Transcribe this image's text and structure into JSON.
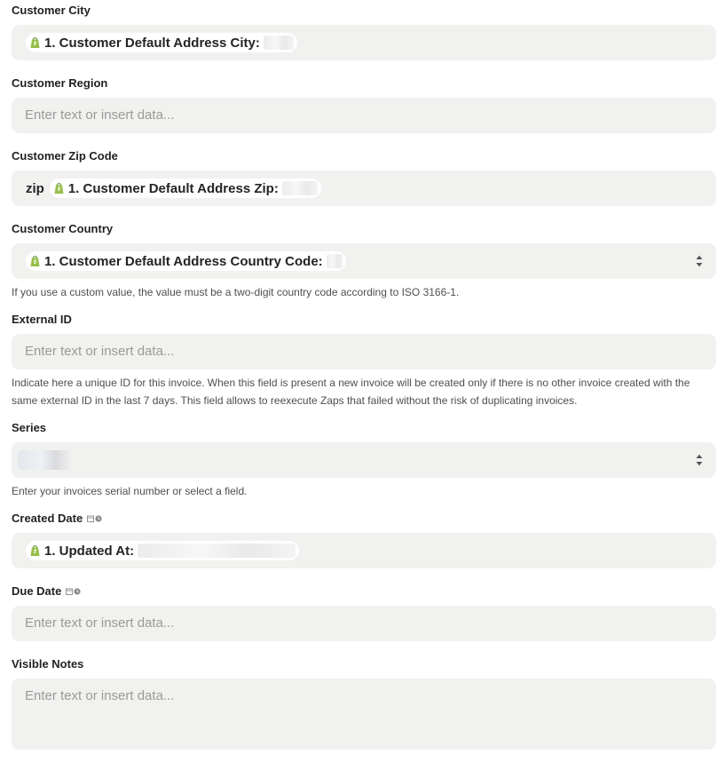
{
  "fields": {
    "city": {
      "label": "Customer City",
      "pill": "1. Customer Default Address City:"
    },
    "region": {
      "label": "Customer Region",
      "placeholder": "Enter text or insert data..."
    },
    "zip": {
      "label": "Customer Zip Code",
      "prefix": "zip",
      "pill": "1. Customer Default Address Zip:"
    },
    "country": {
      "label": "Customer Country",
      "pill": "1. Customer Default Address Country Code:",
      "help": "If you use a custom value, the value must be a two-digit country code according to ISO 3166-1."
    },
    "external_id": {
      "label": "External ID",
      "placeholder": "Enter text or insert data...",
      "help": "Indicate here a unique ID for this invoice. When this field is present a new invoice will be created only if there is no other invoice created with the same external ID in the last 7 days. This field allows to reexecute Zaps that failed without the risk of duplicating invoices."
    },
    "series": {
      "label": "Series",
      "help": "Enter your invoices serial number or select a field."
    },
    "created_date": {
      "label": "Created Date",
      "pill": "1. Updated At:"
    },
    "due_date": {
      "label": "Due Date",
      "placeholder": "Enter text or insert data..."
    },
    "visible_notes": {
      "label": "Visible Notes",
      "placeholder": "Enter text or insert data..."
    }
  },
  "icons": {
    "app": "shopify-icon",
    "dropdown": "select-caret-icon",
    "date": "calendar-icon",
    "time": "clock-icon"
  },
  "colors": {
    "input_background": "#f1f1f0",
    "shopify_green": "#95bf47",
    "placeholder": "#9a9a99"
  }
}
